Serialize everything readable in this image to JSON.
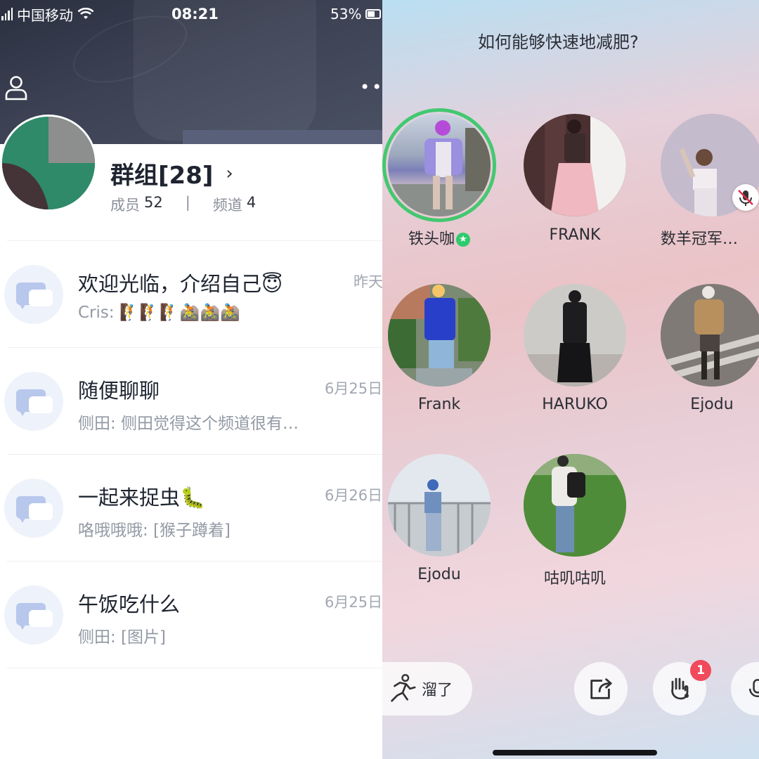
{
  "status_bar": {
    "carrier": "中国移动",
    "time": "08:21",
    "battery": "53%"
  },
  "group": {
    "title": "群组[28]",
    "members_label": "成员",
    "members_count": "52",
    "separator": "|",
    "channels_label": "频道",
    "channels_count": "4"
  },
  "channels": [
    {
      "title": "欢迎光临，介绍自己😇",
      "time": "昨天",
      "subtitle": "Cris: 🧗🧗🧗🚵🚵🚵"
    },
    {
      "title": "随便聊聊",
      "time": "6月25日",
      "subtitle": "侧田: 侧田觉得这个频道很有…"
    },
    {
      "title": "一起来捉虫🐛",
      "time": "6月26日",
      "subtitle": "咯哦哦哦: [猴子蹲着]"
    },
    {
      "title": "午饭吃什么",
      "time": "6月25日",
      "subtitle": "侧田: [图片]"
    }
  ],
  "room": {
    "title": "如何能够快速地减肥?",
    "members": [
      {
        "name": "铁头咖",
        "speaking": true
      },
      {
        "name": "FRANK"
      },
      {
        "name": "数羊冠军…",
        "muted": true
      },
      {
        "name": "Frank"
      },
      {
        "name": "HARUKO"
      },
      {
        "name": "Ejodu"
      },
      {
        "name": "Ejodu"
      },
      {
        "name": "咕叽咕叽"
      }
    ],
    "leave_label": "溜了",
    "hand_raise_count": "1"
  },
  "colors": {
    "accent_green": "#43c870",
    "badge_red": "#f04a5c",
    "header_dark": "#3c4254"
  },
  "icons": [
    "user-icon",
    "more-icon",
    "chevron-right-icon",
    "channel-icon",
    "star-icon",
    "mic-off-icon",
    "walk-icon",
    "share-icon",
    "raise-hand-icon",
    "mic-icon",
    "wifi-icon",
    "battery-icon"
  ]
}
